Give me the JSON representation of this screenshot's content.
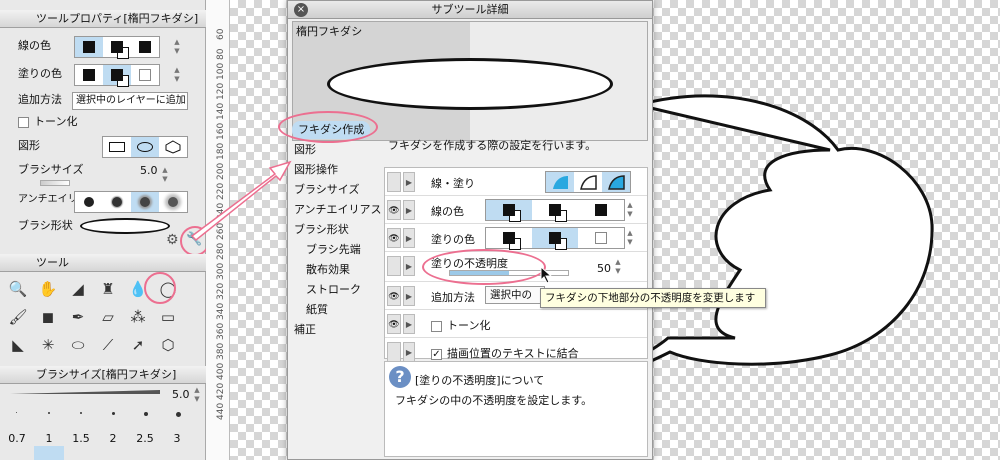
{
  "tool_property": {
    "title": "ツールプロパティ[楕円フキダシ]",
    "rows": {
      "line_color": "線の色",
      "fill_color": "塗りの色",
      "add_method": "追加方法",
      "add_method_value": "選択中のレイヤーに追加",
      "tone": "トーン化",
      "shape": "図形",
      "brush_size": "ブラシサイズ",
      "brush_size_value": "5.0",
      "antialias": "アンチエイリ",
      "brush_shape": "ブラシ形状"
    }
  },
  "tool_panel": {
    "title": "ツール"
  },
  "brush_size_panel": {
    "title": "ブラシサイズ[楕円フキダシ]",
    "value": "5.0",
    "sizes": [
      "0.7",
      "1",
      "1.5",
      "2",
      "2.5",
      "3"
    ]
  },
  "ruler": {
    "ticks": [
      "60",
      "80",
      "100",
      "120",
      "140",
      "160",
      "180",
      "200",
      "220",
      "240",
      "260",
      "280",
      "300",
      "320",
      "340",
      "360",
      "380",
      "400",
      "420",
      "440"
    ]
  },
  "dialog": {
    "title": "サブツール詳細",
    "close": "×",
    "preview_label": "楕円フキダシ",
    "categories": [
      {
        "label": "フキダシ作成",
        "selected": true
      },
      {
        "label": "図形"
      },
      {
        "label": "図形操作"
      },
      {
        "label": "ブラシサイズ"
      },
      {
        "label": "アンチエイリアス"
      },
      {
        "label": "ブラシ形状"
      },
      {
        "label": "ブラシ先端",
        "sub": true
      },
      {
        "label": "散布効果",
        "sub": true
      },
      {
        "label": "ストローク",
        "sub": true
      },
      {
        "label": "紙質",
        "sub": true
      },
      {
        "label": "補正"
      }
    ],
    "description": "フキダシを作成する際の設定を行います。",
    "settings": {
      "line_fill": "線・塗り",
      "line_color": "線の色",
      "fill_color": "塗りの色",
      "fill_opacity": "塗りの不透明度",
      "fill_opacity_value": "50",
      "fill_opacity_level": 0.5,
      "add_method": "追加方法",
      "add_method_value": "選択中の",
      "tone": "トーン化",
      "combine_text": "描画位置のテキストに結合"
    },
    "help": {
      "title": "[塗りの不透明度]について",
      "body": "フキダシの中の不透明度を設定します。"
    }
  },
  "tooltip": "フキダシの下地部分の不透明度を変更します",
  "colors": {
    "accent": "#bfdcf2",
    "highlight_ring": "#ec6f90",
    "selected_category": "#bfdcf2"
  }
}
